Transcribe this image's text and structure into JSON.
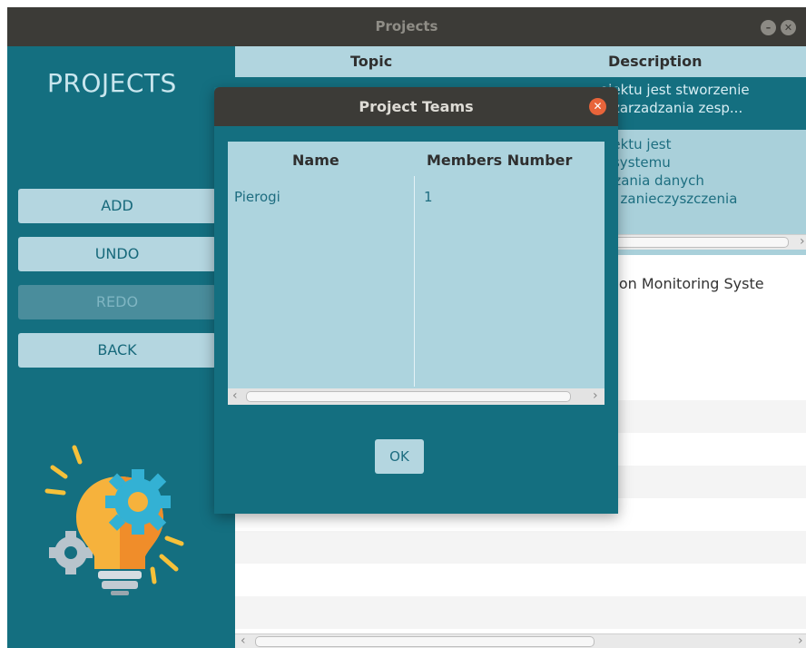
{
  "window": {
    "title": "Projects"
  },
  "sidebar": {
    "heading": "PROJECTS",
    "buttons": [
      {
        "label": "ADD",
        "enabled": true
      },
      {
        "label": "UNDO",
        "enabled": true
      },
      {
        "label": "REDO",
        "enabled": false
      },
      {
        "label": "BACK",
        "enabled": true
      }
    ],
    "illustration_icon": "lightbulb-gears-icon"
  },
  "table": {
    "columns": [
      "Topic",
      "Description"
    ],
    "rows": [
      {
        "description": [
          "ojektu jest stworzenie",
          "o zarzadzania zesp..."
        ]
      },
      {
        "description": [
          "ojektu jest",
          "e systemu",
          "arzania danych",
          "ch zanieczyszczenia",
          "."
        ]
      },
      {
        "description": [
          "ution Monitoring Syste"
        ]
      }
    ]
  },
  "dialog": {
    "title": "Project Teams",
    "columns": [
      "Name",
      "Members Number"
    ],
    "rows": [
      {
        "name": "Pierogi",
        "members": "1"
      }
    ],
    "ok_label": "OK"
  },
  "colors": {
    "accent": "#146f80",
    "light_panel": "#b1d5df",
    "titlebar": "#3c3b37",
    "close": "#e8643a"
  }
}
